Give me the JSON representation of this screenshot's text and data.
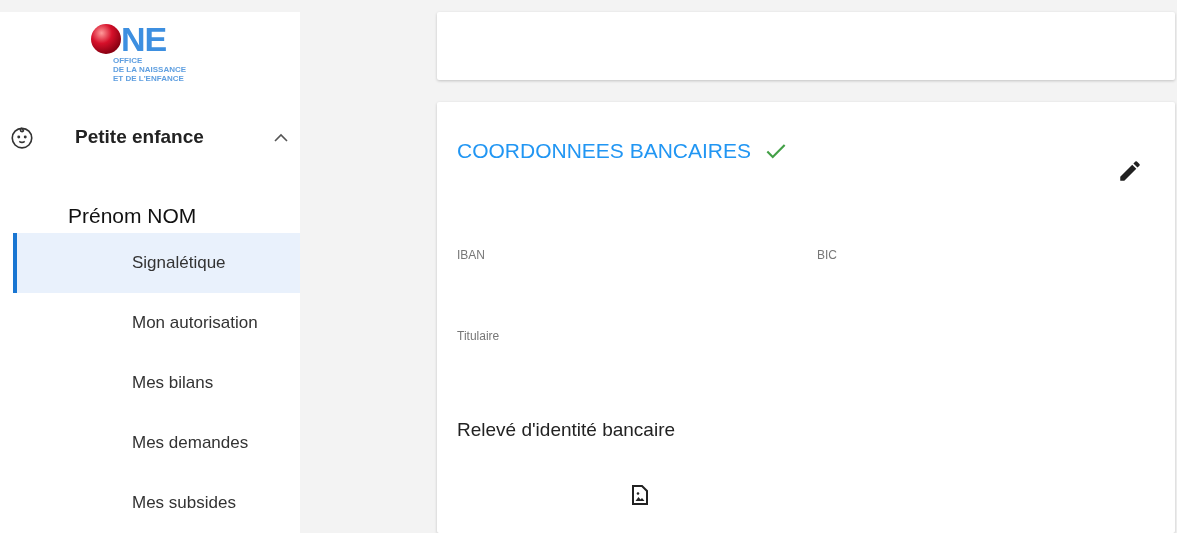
{
  "logo": {
    "mark": "NE",
    "lines": [
      "OFFICE",
      "DE LA NAISSANCE",
      "ET DE L'ENFANCE"
    ]
  },
  "sidebar": {
    "section": {
      "label": "Petite enfance",
      "expanded": true
    },
    "person": "Prénom NOM",
    "items": [
      {
        "label": "Signalétique",
        "selected": true
      },
      {
        "label": "Mon autorisation",
        "selected": false
      },
      {
        "label": "Mes bilans",
        "selected": false
      },
      {
        "label": "Mes demandes",
        "selected": false
      },
      {
        "label": "Mes subsides",
        "selected": false
      }
    ]
  },
  "bank_card": {
    "title": "COORDONNEES BANCAIRES",
    "verified": true,
    "fields": [
      {
        "label": "IBAN"
      },
      {
        "label": "BIC"
      },
      {
        "label": "Titulaire"
      }
    ],
    "document_heading": "Relevé d'identité bancaire"
  }
}
